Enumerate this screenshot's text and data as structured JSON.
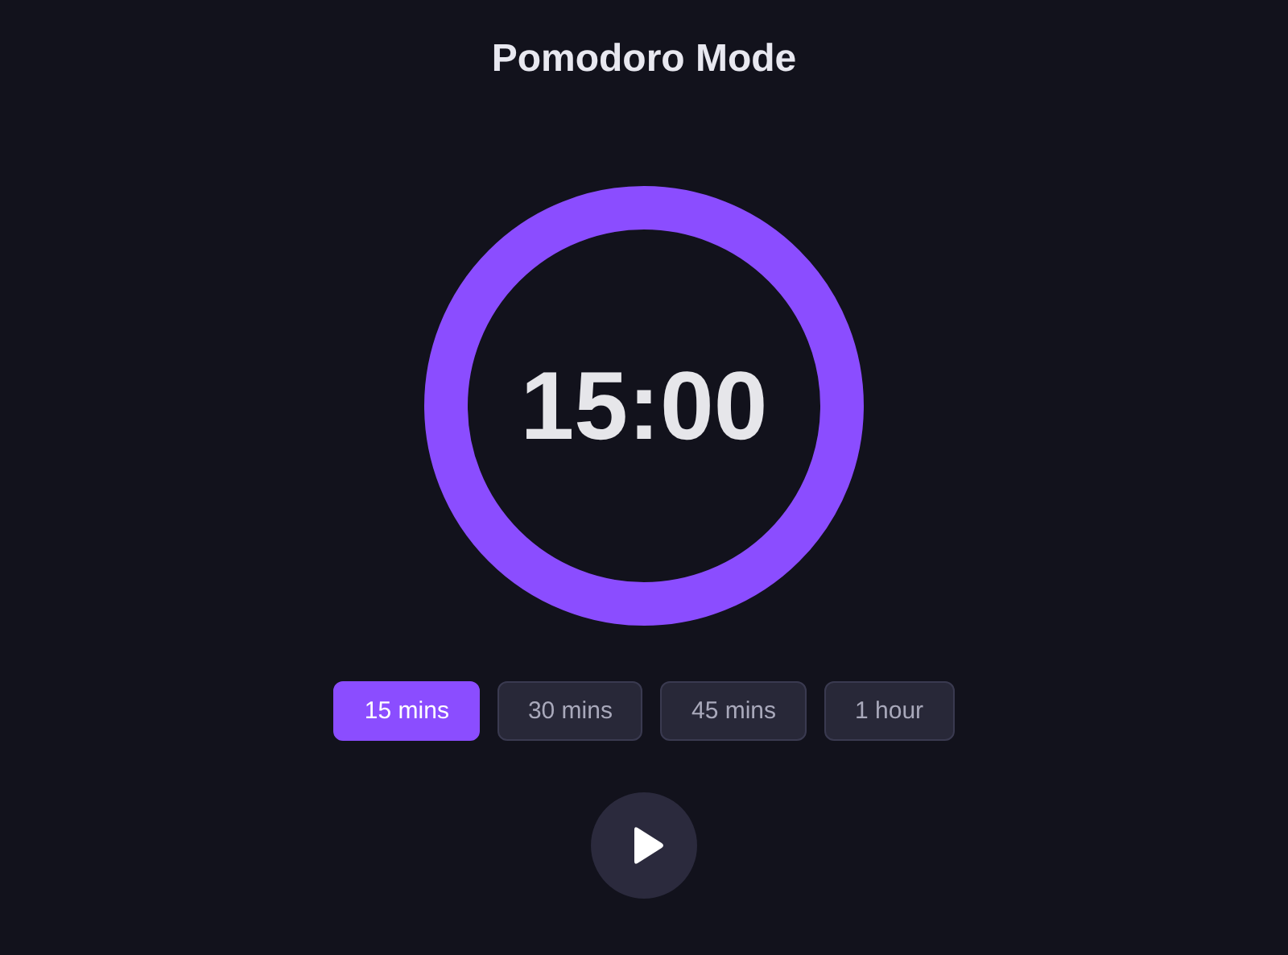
{
  "title": "Pomodoro Mode",
  "timer": {
    "time": "15:00",
    "level": 1
  },
  "durations": [
    {
      "label": "15 mins",
      "selected": true
    },
    {
      "label": "30 mins",
      "selected": false
    },
    {
      "label": "45 mins",
      "selected": false
    },
    {
      "label": "1 hour",
      "selected": false
    }
  ],
  "play_button": {
    "playing": false
  }
}
